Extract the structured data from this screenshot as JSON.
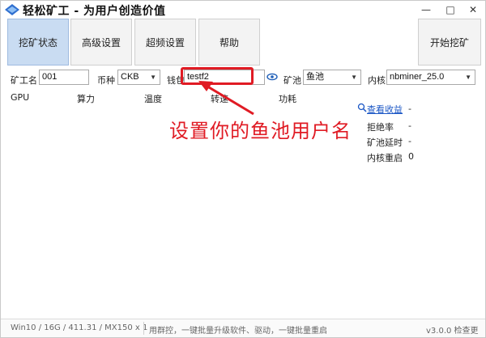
{
  "window": {
    "title": "轻松矿工 - 为用户创造价值",
    "minimize_glyph": "—",
    "maximize_glyph": "□",
    "close_glyph": "✕"
  },
  "toolbar": {
    "status_label": "挖矿状态",
    "advanced_label": "高级设置",
    "overclock_label": "超频设置",
    "help_label": "帮助",
    "start_label": "开始挖矿"
  },
  "config": {
    "miner_name_label": "矿工名",
    "miner_name_value": "001",
    "coin_label": "币种",
    "coin_value": "CKB",
    "wallet_label": "钱包",
    "wallet_value": "testf2",
    "pool_label": "矿池",
    "pool_value": "鱼池",
    "kernel_label": "内核",
    "kernel_value": "nbminer_25.0"
  },
  "table": {
    "columns": [
      "GPU",
      "算力",
      "温度",
      "转速",
      "功耗"
    ]
  },
  "stats": {
    "view_earnings": "查看收益",
    "view_earnings_value": "-",
    "reject_rate_label": "拒绝率",
    "reject_rate_value": "-",
    "pool_latency_label": "矿池延时",
    "pool_latency_value": "-",
    "kernel_restart_label": "内核重启",
    "kernel_restart_value": "0"
  },
  "annotation": {
    "text": "设置你的鱼池用户名",
    "color": "#e01b24"
  },
  "statusbar": {
    "system_info": "Win10 / 16G / 411.31 / MX150 x 1",
    "promo": "用群控，一键批量升级软件、驱动，一键批量重启",
    "version": "v3.0.0 检查更新"
  },
  "colors": {
    "active_tab": "#c9dcf2",
    "link": "#1a56c5",
    "annotation": "#e01b24"
  },
  "icons": {
    "app_logo": "app-logo-icon",
    "eye": "eye-icon",
    "search": "search-icon",
    "combo": "chevron-down-icon"
  }
}
